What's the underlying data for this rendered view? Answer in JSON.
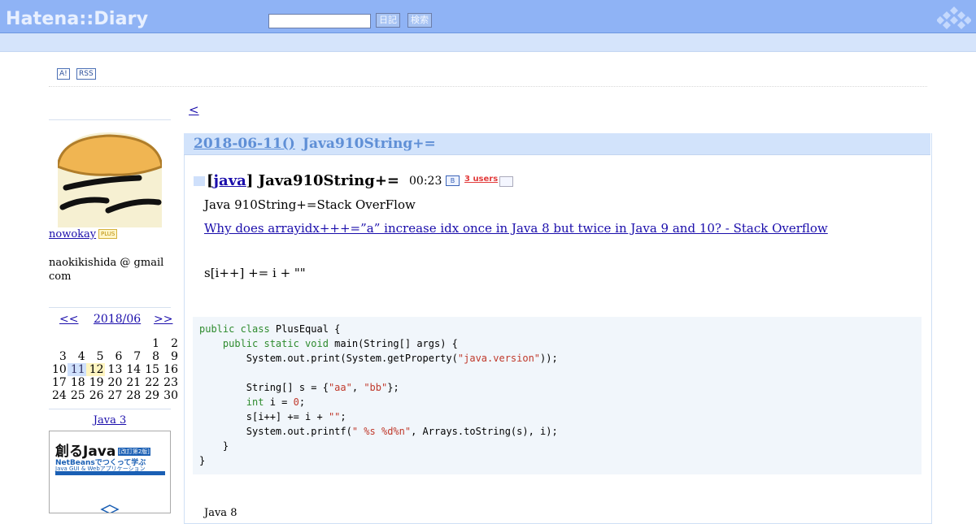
{
  "header": {
    "logo": "Hatena::Diary",
    "search_placeholder": "",
    "diary_button": "日記",
    "search_button": "検索"
  },
  "toolbar": {
    "antenna_icon_label": "A!",
    "rss_label": "RSS"
  },
  "nav": {
    "prev_link": "<"
  },
  "sidebar": {
    "username": "nowokay",
    "plus_badge": "PLUS",
    "profile": "naokikishida @ gmail com",
    "calendar": {
      "prev": "<<",
      "month": "2018/06",
      "next": ">>",
      "weeks": [
        [
          "",
          "",
          "",
          "",
          "",
          "1",
          "2"
        ],
        [
          "3",
          "4",
          "5",
          "6",
          "7",
          "8",
          "9"
        ],
        [
          "10",
          "11",
          "12",
          "13",
          "14",
          "15",
          "16"
        ],
        [
          "17",
          "18",
          "19",
          "20",
          "21",
          "22",
          "23"
        ],
        [
          "24",
          "25",
          "26",
          "27",
          "28",
          "29",
          "30"
        ]
      ],
      "selected_day": "11",
      "highlight_day": "12"
    },
    "book": {
      "title_link": "Java 3",
      "cover_title": "創るJava",
      "cover_edition": "[改訂第2版]",
      "cover_subtitle": "NetBeansでつくって学ぶ",
      "cover_subtitle2": "Java GUI & Webアプリケーション"
    }
  },
  "entry": {
    "date_link": "2018-06-11()",
    "date_title": "Java910String+=",
    "category": "java",
    "title": "Java910String+=",
    "time": "00:23",
    "bookmark_icon": "B",
    "users": "3 users",
    "para1": "Java 910String+=Stack OverFlow",
    "link_text": "Why does arrayidx+++=”a” increase idx once in Java 8 but twice in Java 9 and 10? - Stack Overflow",
    "para2": "s[i++] += i + \"\"",
    "para_bottom": "Java 8",
    "code": {
      "line1_kw": "public class",
      "line1_rest": " PlusEqual {",
      "line2_kw": "    public static void",
      "line2_rest": " main(String[] args) {",
      "line3_a": "        System.out.print(System.getProperty(",
      "line3_str": "\"java.version\"",
      "line3_b": "));",
      "line5_a": "        String[] s = {",
      "line5_str1": "\"aa\"",
      "line5_sep": ", ",
      "line5_str2": "\"bb\"",
      "line5_b": "};",
      "line6_kw": "        int",
      "line6_a": " i = ",
      "line6_num": "0",
      "line6_b": ";",
      "line7_a": "        s[i++] += i + ",
      "line7_str": "\"\"",
      "line7_b": ";",
      "line8_a": "        System.out.printf(",
      "line8_str": "\" %s %d%n\"",
      "line8_b": ", Arrays.toString(s), i);",
      "line9": "    }",
      "line10": "}"
    }
  }
}
